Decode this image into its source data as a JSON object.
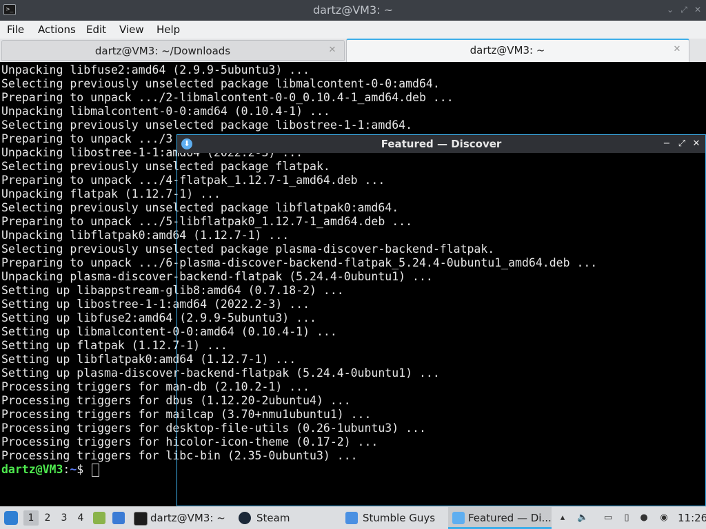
{
  "window": {
    "title": "dartz@VM3: ~",
    "icon": "terminal-icon"
  },
  "menu": [
    "File",
    "Actions",
    "Edit",
    "View",
    "Help"
  ],
  "tabs": [
    {
      "label": "dartz@VM3: ~/Downloads",
      "active": false
    },
    {
      "label": "dartz@VM3: ~",
      "active": true
    }
  ],
  "terminal": {
    "lines": [
      "Unpacking libfuse2:amd64 (2.9.9-5ubuntu3) ...",
      "Selecting previously unselected package libmalcontent-0-0:amd64.",
      "Preparing to unpack .../2-libmalcontent-0-0_0.10.4-1_amd64.deb ...",
      "Unpacking libmalcontent-0-0:amd64 (0.10.4-1) ...",
      "Selecting previously unselected package libostree-1-1:amd64.",
      "Preparing to unpack .../3",
      "Unpacking libostree-1-1:amd64 (2022.2-3) ...",
      "Selecting previously unselected package flatpak.",
      "Preparing to unpack .../4-flatpak_1.12.7-1_amd64.deb ...",
      "Unpacking flatpak (1.12.7-1) ...",
      "Selecting previously unselected package libflatpak0:amd64.",
      "Preparing to unpack .../5-libflatpak0_1.12.7-1_amd64.deb ...",
      "Unpacking libflatpak0:amd64 (1.12.7-1) ...",
      "Selecting previously unselected package plasma-discover-backend-flatpak.",
      "Preparing to unpack .../6-plasma-discover-backend-flatpak_5.24.4-0ubuntu1_amd64.deb ...",
      "Unpacking plasma-discover-backend-flatpak (5.24.4-0ubuntu1) ...",
      "Setting up libappstream-glib8:amd64 (0.7.18-2) ...",
      "Setting up libostree-1-1:amd64 (2022.2-3) ...",
      "Setting up libfuse2:amd64 (2.9.9-5ubuntu3) ...",
      "Setting up libmalcontent-0-0:amd64 (0.10.4-1) ...",
      "Setting up flatpak (1.12.7-1) ...",
      "Setting up libflatpak0:amd64 (1.12.7-1) ...",
      "Setting up plasma-discover-backend-flatpak (5.24.4-0ubuntu1) ...",
      "Processing triggers for man-db (2.10.2-1) ...",
      "Processing triggers for dbus (1.12.20-2ubuntu4) ...",
      "Processing triggers for mailcap (3.70+nmu1ubuntu1) ...",
      "Processing triggers for desktop-file-utils (0.26-1ubuntu3) ...",
      "Processing triggers for hicolor-icon-theme (0.17-2) ...",
      "Processing triggers for libc-bin (2.35-0ubuntu3) ..."
    ],
    "prompt_user": "dartz@VM3",
    "prompt_sep": ":",
    "prompt_path": "~",
    "prompt_end": "$"
  },
  "discover": {
    "title": "Featured — Discover",
    "icon": "discover-icon"
  },
  "taskbar": {
    "desktops": [
      "1",
      "2",
      "3",
      "4"
    ],
    "tasks": [
      {
        "label": "dartz@VM3: ~",
        "icon": "terminal-icon"
      },
      {
        "label": "Steam",
        "icon": "steam-icon"
      },
      {
        "label": "Stumble Guys",
        "icon": "folder-icon"
      },
      {
        "label": "Featured — Di...",
        "icon": "discover-icon"
      }
    ],
    "clock": "11:26"
  },
  "colors": {
    "accent": "#3daee9",
    "prompt_user": "#4ee94e",
    "prompt_path": "#5b7cf5"
  }
}
